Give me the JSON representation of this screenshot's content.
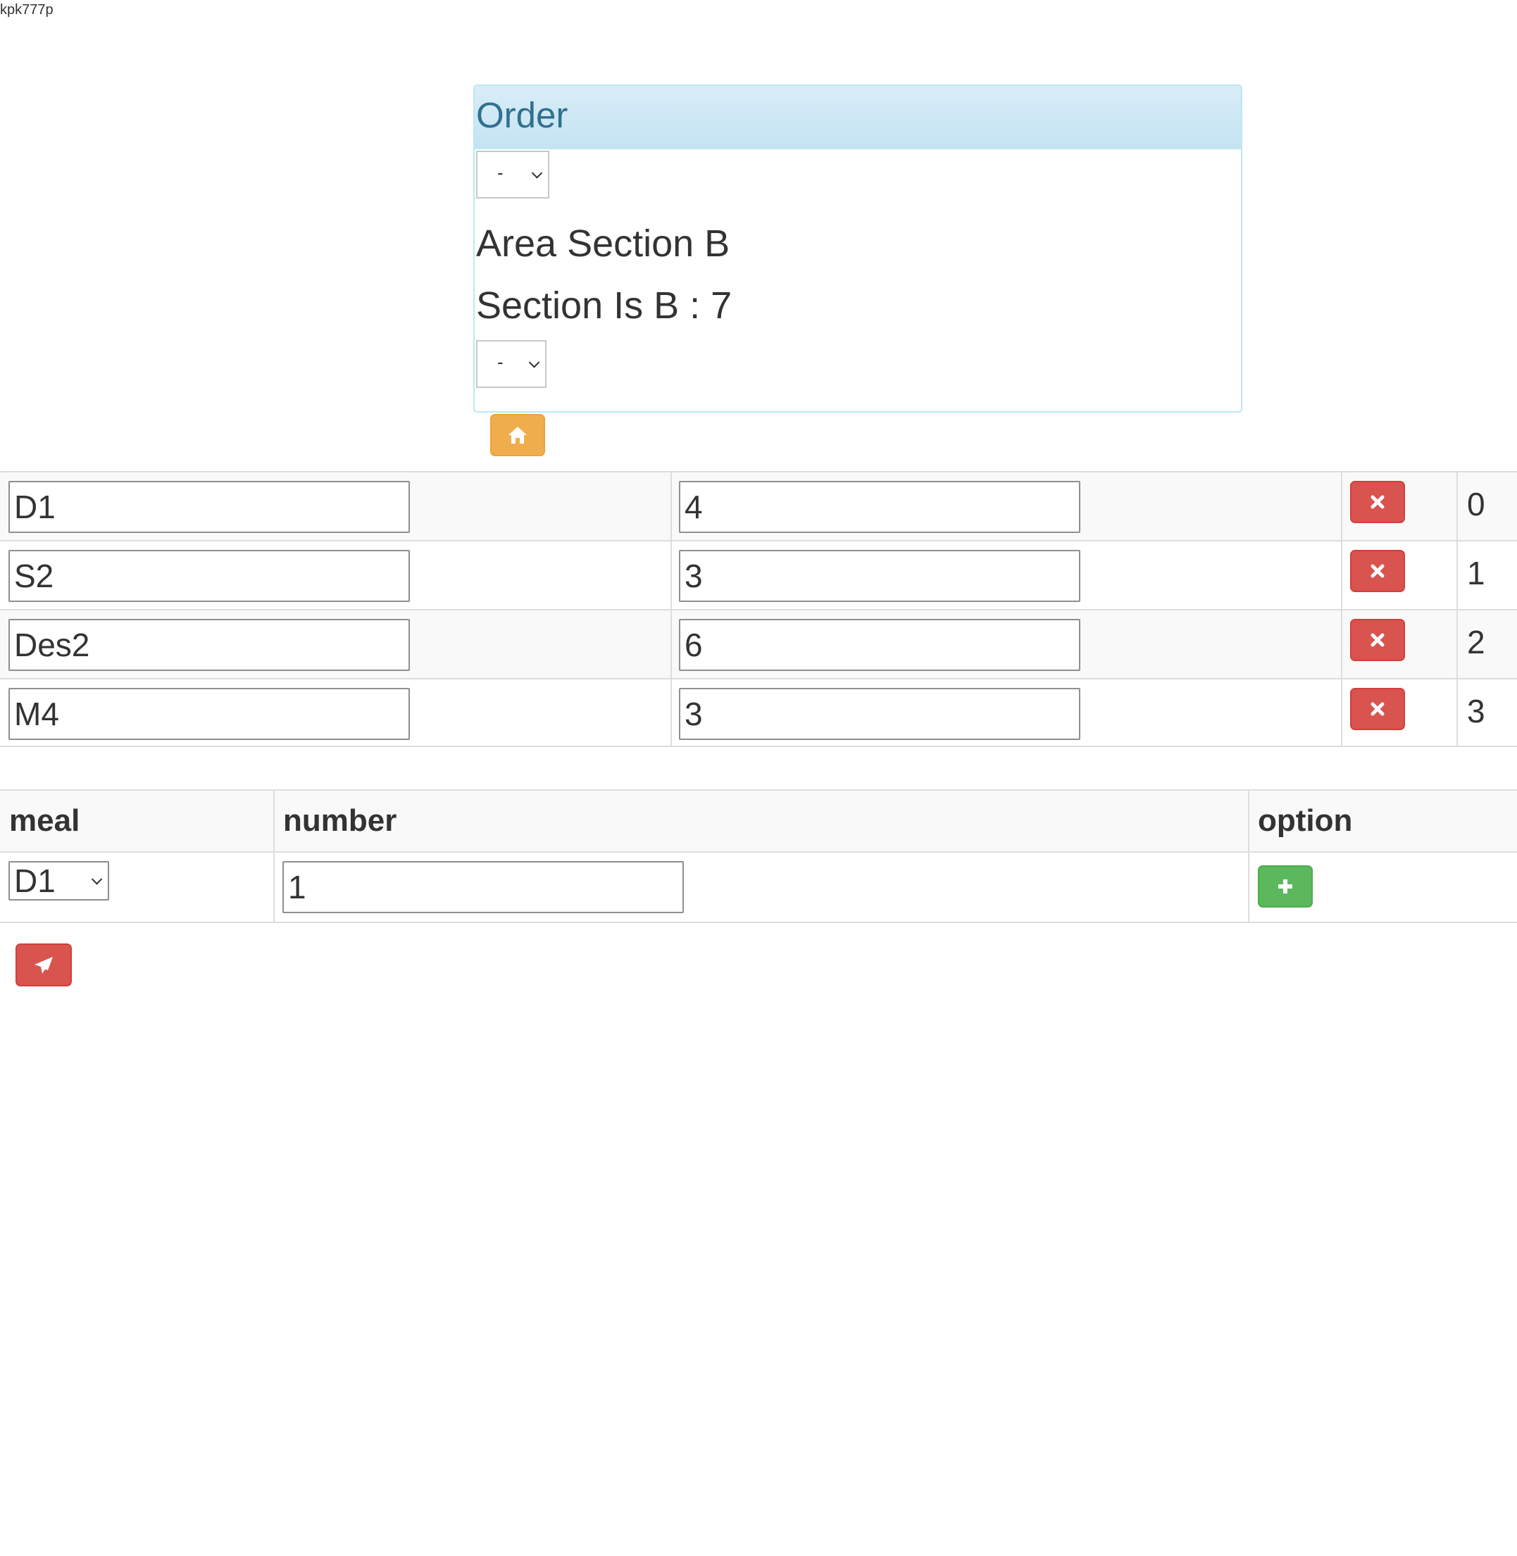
{
  "user": {
    "name": "kpk777p"
  },
  "panel": {
    "title": "Order",
    "section_select": {
      "value": "-"
    },
    "area_text": "Area Section B",
    "section_text": "Section Is B : 7",
    "table_select": {
      "value": "-"
    }
  },
  "home_button": {
    "icon": "home-icon"
  },
  "order_items": [
    {
      "meal": "D1",
      "number": "4",
      "index": "0"
    },
    {
      "meal": "S2",
      "number": "3",
      "index": "1"
    },
    {
      "meal": "Des2",
      "number": "6",
      "index": "2"
    },
    {
      "meal": "M4",
      "number": "3",
      "index": "3"
    }
  ],
  "add_table": {
    "headers": {
      "meal": "meal",
      "number": "number",
      "option": "option"
    },
    "meal_value": "D1",
    "number_value": "1"
  },
  "colors": {
    "panel_heading": "#d9edf7",
    "panel_title": "#31708f",
    "warning": "#f0ad4e",
    "danger": "#d9534f",
    "success": "#5cb85c"
  },
  "icons": {
    "delete": "remove-icon",
    "add": "plus-icon",
    "submit": "send-icon"
  }
}
